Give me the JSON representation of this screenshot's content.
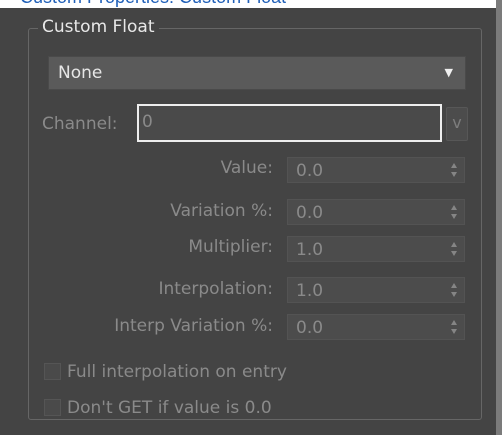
{
  "header": {
    "strip_text": "Custom Properties: Custom Float"
  },
  "group": {
    "title": "Custom Float"
  },
  "dropdown": {
    "selected": "None",
    "arrow": "▼"
  },
  "channel": {
    "label": "Channel:",
    "value": "0",
    "button": "v"
  },
  "fields": [
    {
      "label": "Value:",
      "value": "0.0"
    },
    {
      "label": "Variation %:",
      "value": "0.0"
    },
    {
      "label": "Multiplier:",
      "value": "1.0"
    },
    {
      "label": "Interpolation:",
      "value": "1.0"
    },
    {
      "label": "Interp Variation %:",
      "value": "0.0"
    }
  ],
  "checkboxes": [
    {
      "label": "Full interpolation on entry",
      "checked": false
    },
    {
      "label": "Don't GET if value is 0.0",
      "checked": false
    }
  ],
  "colors": {
    "panel_bg": "#444444",
    "field_bg": "#4c4c4c",
    "disabled_text": "#8a8a8a",
    "focus_border": "#eeeeee"
  }
}
